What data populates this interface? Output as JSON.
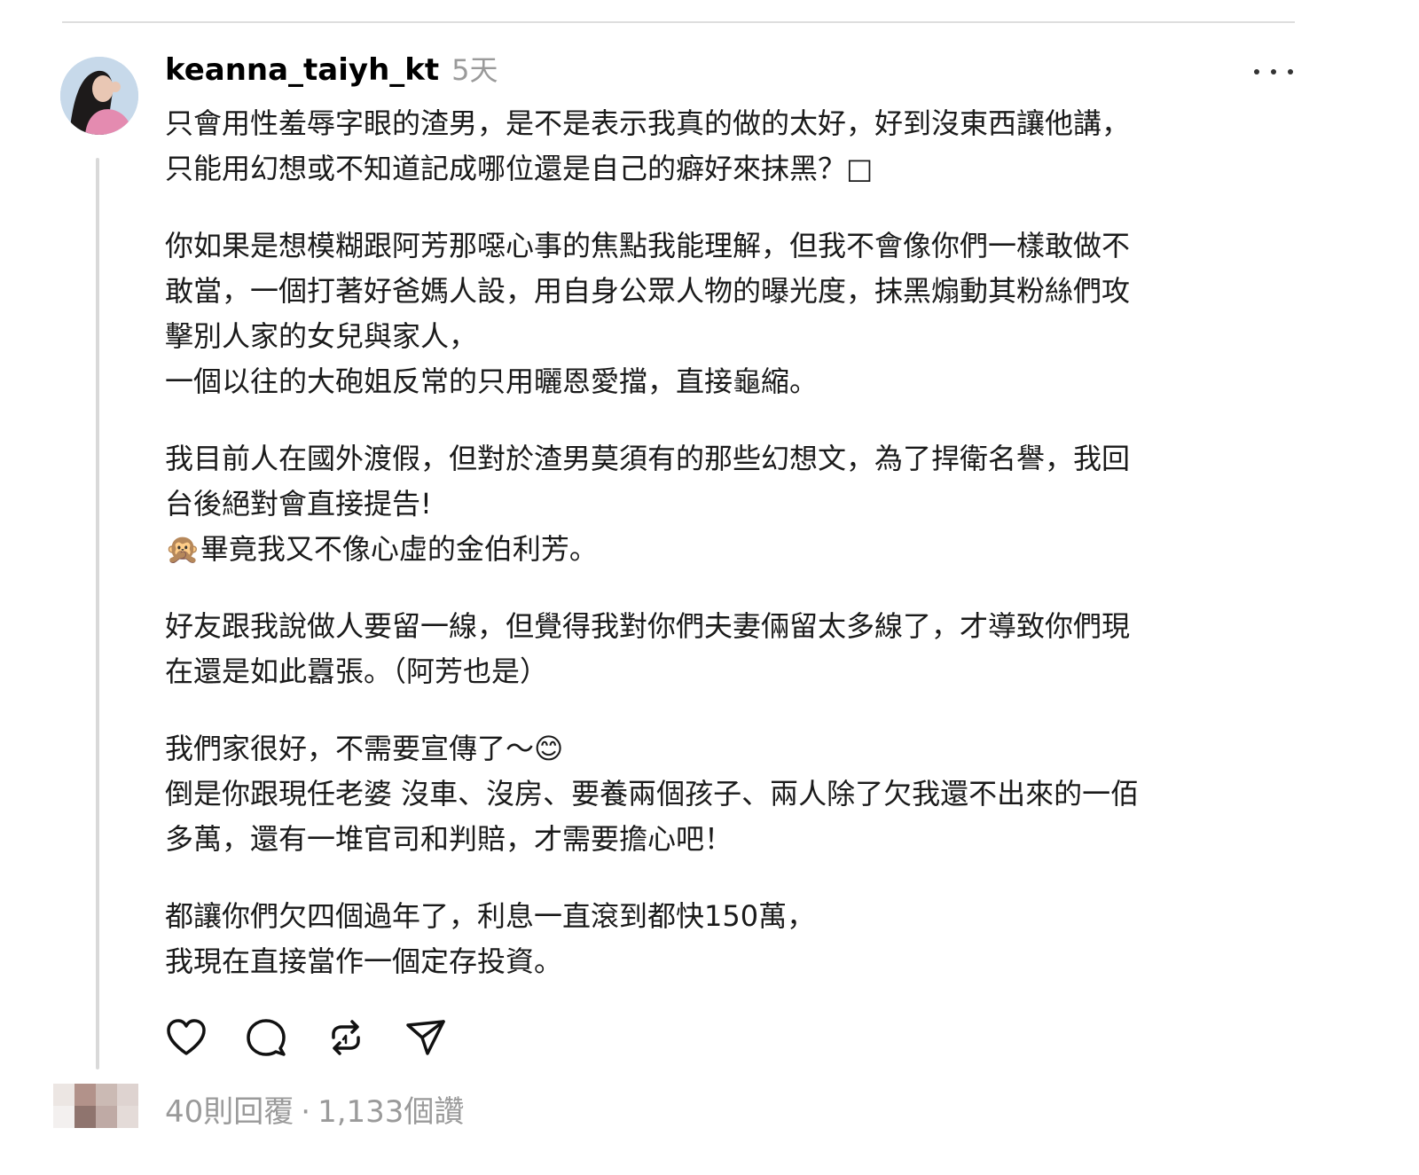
{
  "post": {
    "username": "keanna_taiyh_kt",
    "time": "5天",
    "more_icon": "more-horizontal-icon",
    "paragraphs": [
      "只會用性羞辱字眼的渣男，是不是表示我真的做的太好，好到沒東西讓他講，\n只能用幻想或不知道記成哪位還是自己的癖好來抹黑？□",
      "你如果是想模糊跟阿芳那噁心事的焦點我能理解，但我不會像你們一樣敢做不\n敢當，一個打著好爸媽人設，用自身公眾人物的曝光度，抹黑煽動其粉絲們攻\n擊別人家的女兒與家人，\n一個以往的大砲姐反常的只用曬恩愛擋，直接龜縮。",
      "我目前人在國外渡假，但對於渣男莫須有的那些幻想文，為了捍衛名譽，我回\n台後絕對會直接提告!\n🙊畢竟我又不像心虛的金伯利芳。",
      "好友跟我說做人要留一線，但覺得我對你們夫妻倆留太多線了，才導致你們現\n在還是如此囂張。（阿芳也是）",
      "我們家很好，不需要宣傳了～😊\n倒是你跟現任老婆 沒車、沒房、要養兩個孩子、兩人除了欠我還不出來的一佰\n多萬，還有一堆官司和判賠，才需要擔心吧！",
      "都讓你們欠四個過年了，利息一直滾到都快150萬，\n我現在直接當作一個定存投資。"
    ]
  },
  "actions": {
    "like_icon": "heart-icon",
    "reply_icon": "comment-icon",
    "repost_icon": "repost-icon",
    "share_icon": "send-icon"
  },
  "stats": {
    "replies": "40則回覆",
    "separator": "·",
    "likes": "1,133個讚"
  }
}
